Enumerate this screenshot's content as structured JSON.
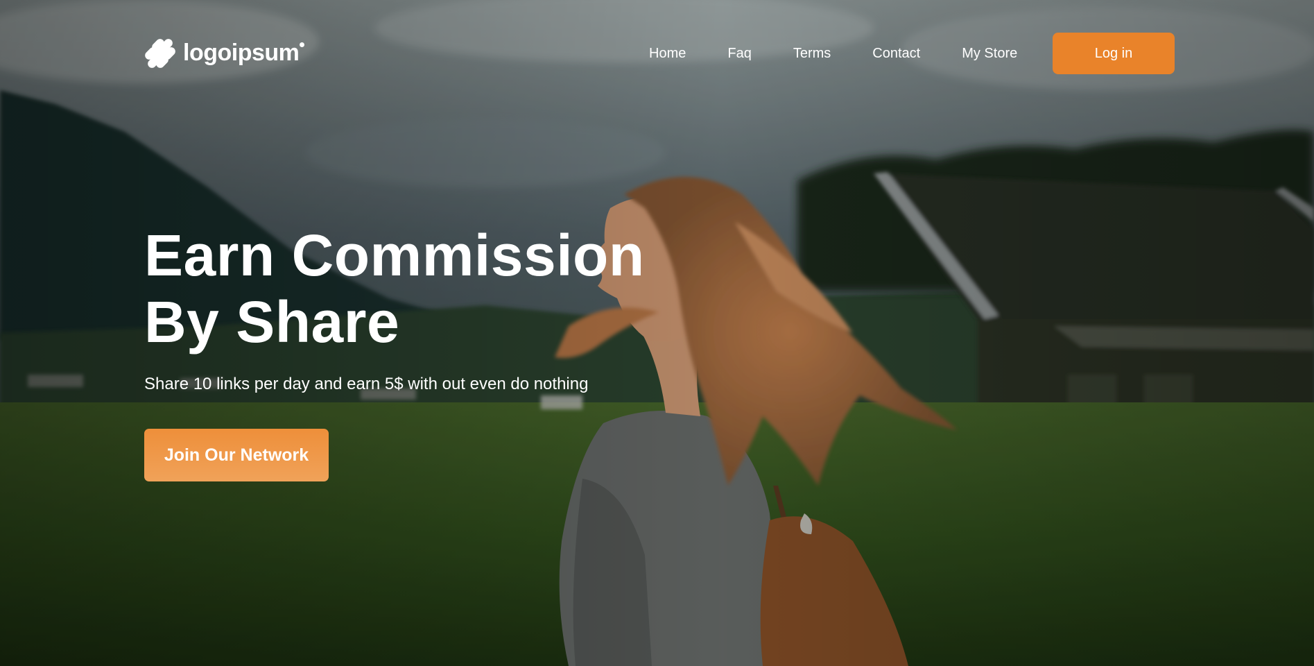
{
  "brand": {
    "logo_text": "logoipsum",
    "accent_color": "#e9832a"
  },
  "nav": {
    "items": [
      {
        "label": "Home"
      },
      {
        "label": "Faq"
      },
      {
        "label": "Terms"
      },
      {
        "label": "Contact"
      },
      {
        "label": "My Store"
      }
    ],
    "login_label": "Log in"
  },
  "hero": {
    "title_line1": "Earn Commission",
    "title_line2": "By Share",
    "subtitle": "Share 10 links per day and earn 5$ with out even do nothing",
    "cta_label": "Join Our Network"
  },
  "background": {
    "icon": "woman-in-field-photo"
  }
}
